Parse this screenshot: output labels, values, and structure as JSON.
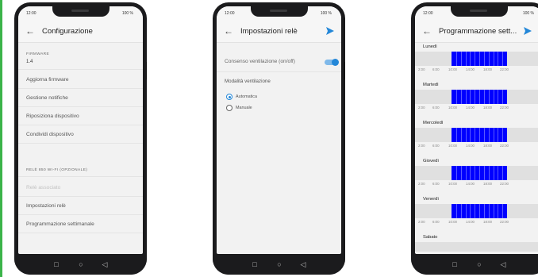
{
  "status": {
    "time": "12:00",
    "battery": "100 %"
  },
  "phone1": {
    "title": "Configurazione",
    "firmware_label": "FIRMWARE",
    "firmware_value": "1.4",
    "items": [
      {
        "label": "Aggiorna firmware"
      },
      {
        "label": "Gestione notifiche"
      },
      {
        "label": "Riposiziona dispositivo"
      },
      {
        "label": "Condividi dispositivo"
      }
    ],
    "section_label": "RELÈ 850 WI-FI (OPZIONALE)",
    "relay_items": [
      {
        "label": "Relè associato",
        "disabled": true
      },
      {
        "label": "Impostazioni relè",
        "disabled": false
      },
      {
        "label": "Programmazione settimanale",
        "disabled": false
      }
    ]
  },
  "phone2": {
    "title": "Impostazioni relè",
    "toggle_label": "Consenso ventilazione (on/off)",
    "toggle_on": true,
    "section_label": "Modalità ventilazione",
    "options": [
      {
        "label": "Automatica",
        "selected": true
      },
      {
        "label": "Manuale",
        "selected": false
      }
    ],
    "accent_color": "#2387d8"
  },
  "phone3": {
    "title": "Programmazione sett...",
    "tick_labels": [
      "2:00",
      "6:00",
      "10:00",
      "14:00",
      "18:00",
      "22:00"
    ],
    "days": [
      {
        "name": "Lunedì"
      },
      {
        "name": "Martedì"
      },
      {
        "name": "Mercoledì"
      },
      {
        "name": "Giovedì"
      },
      {
        "name": "Venerdì"
      },
      {
        "name": "Sabato"
      }
    ],
    "schedule_color": "#0000ff"
  }
}
